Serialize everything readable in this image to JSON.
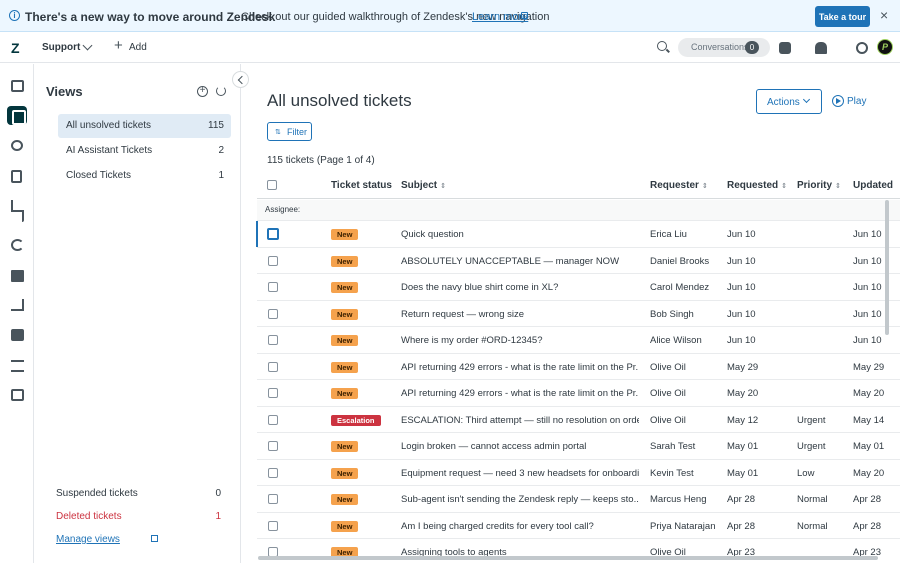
{
  "banner": {
    "title": "There's a new way to move around Zendesk",
    "text": "Check out our guided walkthrough of Zendesk's new navigation",
    "link": "Learn more",
    "tour_button": "Take a tour",
    "close": "×"
  },
  "topbar": {
    "logo": "Z",
    "product": "Support",
    "add_icon": "+",
    "add_label": "Add",
    "conversations_label": "Conversations",
    "conversations_count": "0",
    "avatar_initial": "P"
  },
  "views": {
    "title": "Views",
    "add_icon": "+",
    "items": [
      {
        "label": "All unsolved tickets",
        "count": "115"
      },
      {
        "label": "AI Assistant Tickets",
        "count": "2"
      },
      {
        "label": "Closed Tickets",
        "count": "1"
      }
    ],
    "footer": [
      {
        "label": "Suspended tickets",
        "count": "0"
      },
      {
        "label": "Deleted tickets",
        "count": "1"
      }
    ],
    "manage_link": "Manage views"
  },
  "main": {
    "title": "All unsolved tickets",
    "actions_label": "Actions",
    "play_label": "Play",
    "filter_icon": "⇅",
    "filter_label": "Filter",
    "ticket_count": "115 tickets  (Page 1 of 4)",
    "sort_icon": "⇕",
    "columns": [
      "Ticket status",
      "Subject",
      "Requester",
      "Requested",
      "Priority",
      "Updated"
    ],
    "group_label": "Assignee:"
  },
  "tickets": [
    {
      "status": "New",
      "subject": "Quick question",
      "requester": "Erica Liu",
      "requested": "Jun 10",
      "priority": "",
      "updated": "Jun 10"
    },
    {
      "status": "New",
      "subject": "ABSOLUTELY UNACCEPTABLE — manager NOW",
      "requester": "Daniel Brooks",
      "requested": "Jun 10",
      "priority": "",
      "updated": "Jun 10"
    },
    {
      "status": "New",
      "subject": "Does the navy blue shirt come in XL?",
      "requester": "Carol Mendez",
      "requested": "Jun 10",
      "priority": "",
      "updated": "Jun 10"
    },
    {
      "status": "New",
      "subject": "Return request — wrong size",
      "requester": "Bob Singh",
      "requested": "Jun 10",
      "priority": "",
      "updated": "Jun 10"
    },
    {
      "status": "New",
      "subject": "Where is my order #ORD-12345?",
      "requester": "Alice Wilson",
      "requested": "Jun 10",
      "priority": "",
      "updated": "Jun 10"
    },
    {
      "status": "New",
      "subject": "API returning 429 errors - what is the rate limit on the Pr...",
      "requester": "Olive Oil",
      "requested": "May 29",
      "priority": "",
      "updated": "May 29"
    },
    {
      "status": "New",
      "subject": "API returning 429 errors - what is the rate limit on the Pr...",
      "requester": "Olive Oil",
      "requested": "May 20",
      "priority": "",
      "updated": "May 20"
    },
    {
      "status": "Escalation",
      "subject": "ESCALATION: Third attempt — still no resolution on orde...",
      "requester": "Olive Oil",
      "requested": "May 12",
      "priority": "Urgent",
      "updated": "May 14"
    },
    {
      "status": "New",
      "subject": "Login broken — cannot access admin portal",
      "requester": "Sarah Test",
      "requested": "May 01",
      "priority": "Urgent",
      "updated": "May 01"
    },
    {
      "status": "New",
      "subject": "Equipment request — need 3 new headsets for onboardi...",
      "requester": "Kevin Test",
      "requested": "May 01",
      "priority": "Low",
      "updated": "May 20"
    },
    {
      "status": "New",
      "subject": "Sub-agent isn't sending the Zendesk reply — keeps sto...",
      "requester": "Marcus Heng",
      "requested": "Apr 28",
      "priority": "Normal",
      "updated": "Apr 28"
    },
    {
      "status": "New",
      "subject": "Am I being charged credits for every tool call?",
      "requester": "Priya Natarajan",
      "requested": "Apr 28",
      "priority": "Normal",
      "updated": "Apr 28"
    },
    {
      "status": "New",
      "subject": "Assigning tools to agents",
      "requester": "Olive Oil",
      "requested": "Apr 23",
      "priority": "",
      "updated": "Apr 23"
    }
  ]
}
